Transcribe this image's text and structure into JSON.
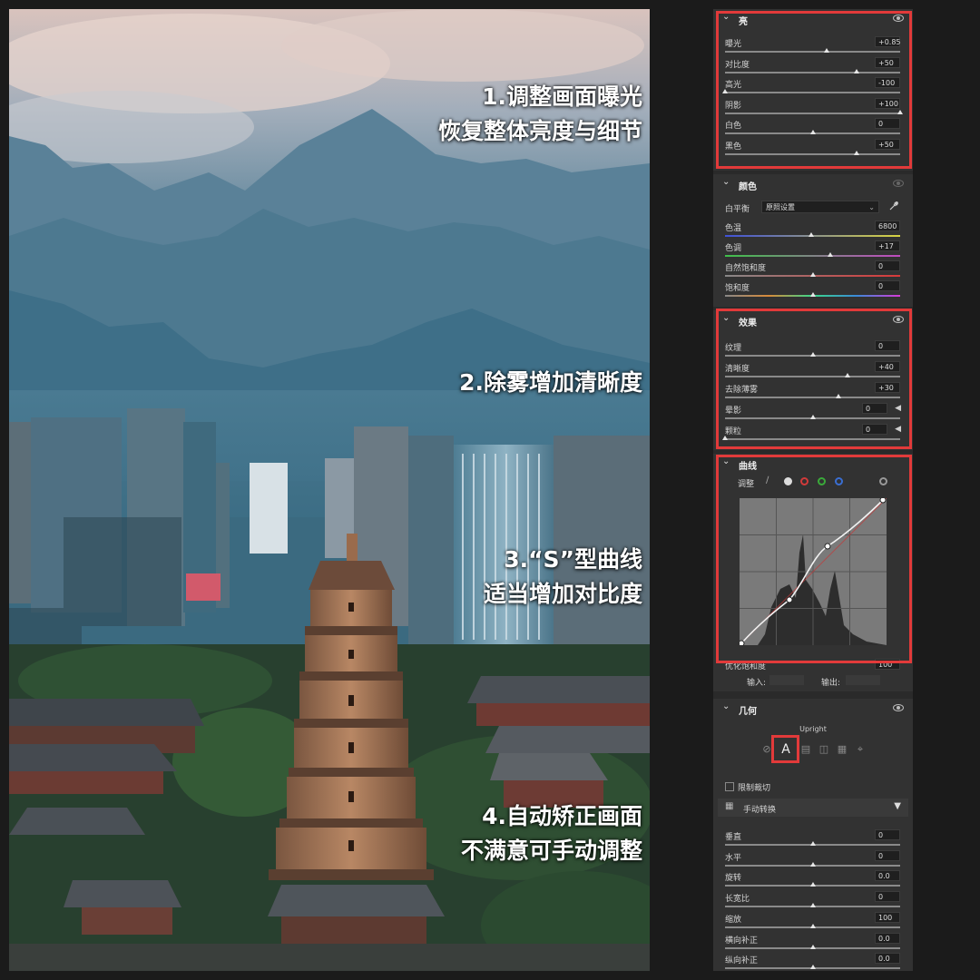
{
  "photo": {
    "captions": [
      {
        "lines": [
          "1.调整画面曝光",
          "恢复整体亮度与细节"
        ]
      },
      {
        "lines": [
          "2.除雾增加清晰度"
        ]
      },
      {
        "lines": [
          "3.“S”型曲线",
          "适当增加对比度"
        ]
      },
      {
        "lines": [
          "4.自动矫正画面",
          "不满意可手动调整"
        ]
      }
    ]
  },
  "panel": {
    "light": {
      "title": "亮",
      "sliders": [
        {
          "label": "曝光",
          "value": "+0.85",
          "pos": 0.58
        },
        {
          "label": "对比度",
          "value": "+50",
          "pos": 0.75
        },
        {
          "label": "高光",
          "value": "-100",
          "pos": 0.0
        },
        {
          "label": "阴影",
          "value": "+100",
          "pos": 1.0
        },
        {
          "label": "白色",
          "value": "0",
          "pos": 0.5
        },
        {
          "label": "黑色",
          "value": "+50",
          "pos": 0.75
        }
      ]
    },
    "color": {
      "title": "颜色",
      "wb_label": "白平衡",
      "wb_value": "原照设置",
      "sliders": [
        {
          "label": "色温",
          "value": "6800",
          "pos": 0.49,
          "track": "temp"
        },
        {
          "label": "色调",
          "value": "+17",
          "pos": 0.6,
          "track": "tint"
        },
        {
          "label": "自然饱和度",
          "value": "0",
          "pos": 0.5,
          "track": "vib"
        },
        {
          "label": "饱和度",
          "value": "0",
          "pos": 0.5,
          "track": "sat"
        }
      ]
    },
    "effects": {
      "title": "效果",
      "sliders": [
        {
          "label": "纹理",
          "value": "0",
          "pos": 0.5
        },
        {
          "label": "清晰度",
          "value": "+40",
          "pos": 0.7
        },
        {
          "label": "去除薄雾",
          "value": "+30",
          "pos": 0.65
        },
        {
          "label": "晕影",
          "value": "0",
          "pos": 0.5
        },
        {
          "label": "颗粒",
          "value": "0",
          "pos": 0.0
        }
      ]
    },
    "curve": {
      "title": "曲线",
      "adjust_label": "调整",
      "refine_label": "优化饱和度",
      "refine_value": "100",
      "input_label": "输入:",
      "output_label": "输出:"
    },
    "geometry": {
      "title": "几何",
      "upright_label": "Upright",
      "auto_label": "A",
      "constrain_label": "限制裁切",
      "manual_label": "手动转换",
      "sliders": [
        {
          "label": "垂直",
          "value": "0",
          "pos": 0.5
        },
        {
          "label": "水平",
          "value": "0",
          "pos": 0.5
        },
        {
          "label": "旋转",
          "value": "0.0",
          "pos": 0.5
        },
        {
          "label": "长宽比",
          "value": "0",
          "pos": 0.5
        },
        {
          "label": "缩放",
          "value": "100",
          "pos": 0.5
        },
        {
          "label": "横向补正",
          "value": "0.0",
          "pos": 0.5
        },
        {
          "label": "纵向补正",
          "value": "0.0",
          "pos": 0.5
        }
      ]
    }
  }
}
